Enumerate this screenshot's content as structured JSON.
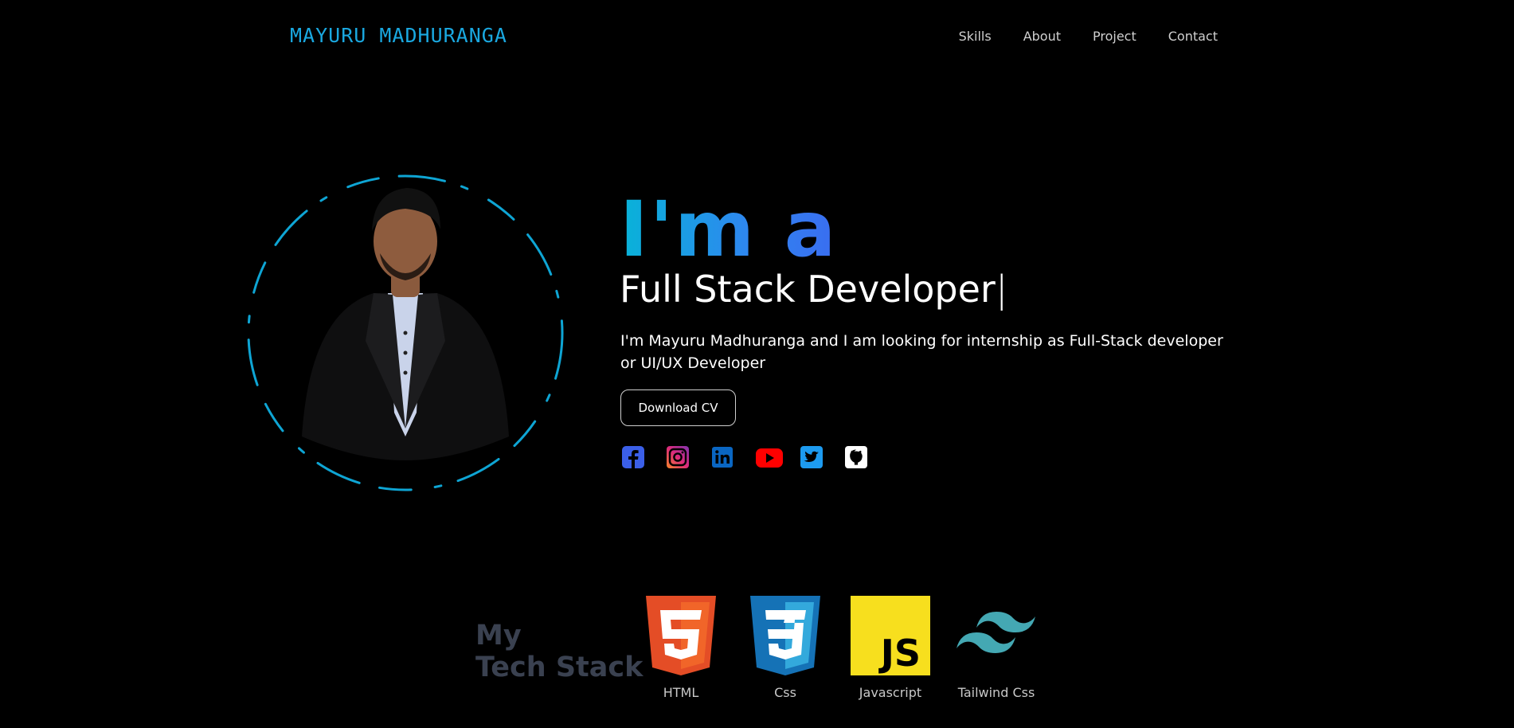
{
  "nav": {
    "logo": "MAYURU MADHURANGA",
    "links": [
      "Skills",
      "About",
      "Project",
      "Contact"
    ]
  },
  "hero": {
    "greeting": "I'm a",
    "role": "Full Stack Developer",
    "cursor": "|",
    "description": "I'm Mayuru Madhuranga and I am looking for internship as Full-Stack developer or UI/UX Developer",
    "cv_button": "Download CV"
  },
  "socials": [
    {
      "icon": "facebook-icon",
      "color": "#3b5fe8"
    },
    {
      "icon": "instagram-icon",
      "color": "#c13584"
    },
    {
      "icon": "linkedin-icon",
      "color": "#0a66c2"
    },
    {
      "icon": "youtube-icon",
      "color": "#ff0000"
    },
    {
      "icon": "twitter-icon",
      "color": "#1d9bf0"
    },
    {
      "icon": "github-icon",
      "color": "#ffffff"
    }
  ],
  "stack": {
    "title_line1": "My",
    "title_line2": "Tech Stack",
    "items": [
      {
        "label": "HTML",
        "icon": "html5-icon"
      },
      {
        "label": "Css",
        "icon": "css3-icon"
      },
      {
        "label": "Javascript",
        "icon": "javascript-icon"
      },
      {
        "label": "Tailwind Css",
        "icon": "tailwind-icon"
      }
    ]
  },
  "colors": {
    "accent": "#1aa8e0",
    "ring": "#0ea5d4",
    "background": "#000000"
  }
}
